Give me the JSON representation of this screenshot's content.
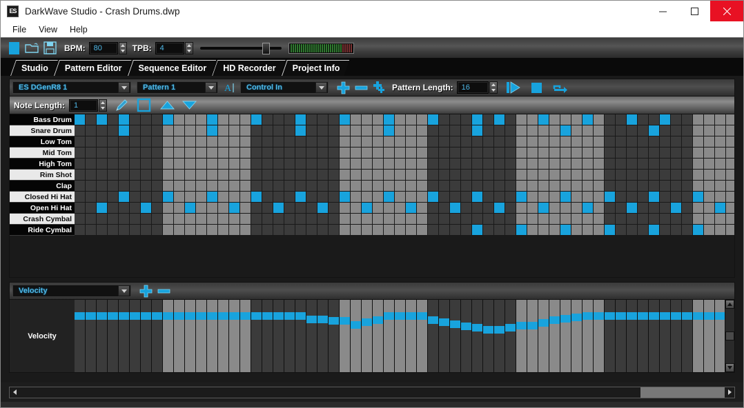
{
  "window": {
    "title": "DarkWave Studio - Crash Drums.dwp",
    "app_icon": "ES",
    "minimize_label": "minimize",
    "maximize_label": "maximize",
    "close_label": "close",
    "close_color": "#e81123"
  },
  "menu": {
    "items": [
      "File",
      "View",
      "Help"
    ]
  },
  "toolbar": {
    "icons": [
      "new-file-icon",
      "open-folder-icon",
      "save-disk-icon"
    ],
    "bpm_label": "BPM:",
    "bpm_value": "80",
    "tpb_label": "TPB:",
    "tpb_value": "4",
    "volume_slider_value": 78,
    "meter_name": "level-meter"
  },
  "tabs": {
    "items": [
      "Studio",
      "Pattern Editor",
      "Sequence Editor",
      "HD Recorder",
      "Project Info"
    ],
    "active": "Pattern Editor"
  },
  "pattern_toolbar": {
    "machine": "ES DGenR8 1",
    "pattern": "Pattern 1",
    "rename_icon": "rename-text-icon",
    "control": "Control In",
    "add_label": "+",
    "remove_label": "–",
    "add_multi_label": "add-multiple",
    "pattern_length_label": "Pattern Length:",
    "pattern_length_value": "16",
    "play_label": "play",
    "stop_label": "stop",
    "loop_label": "loop"
  },
  "note_toolbar": {
    "note_length_label": "Note Length:",
    "note_length_value": "1",
    "pencil_icon": "pencil-tool-icon",
    "select_icon": "select-rect-icon",
    "up_icon": "triangle-up-icon",
    "down_icon": "triangle-down-icon"
  },
  "accent_color": "#18a3dd",
  "grid": {
    "columns": 60,
    "rows": [
      {
        "name": "Bass Drum",
        "steps": [
          0,
          2,
          4,
          8,
          12,
          16,
          20,
          24,
          28,
          32,
          36,
          38,
          42,
          46,
          50,
          53
        ]
      },
      {
        "name": "Snare Drum",
        "steps": [
          4,
          12,
          20,
          28,
          36,
          44,
          52
        ]
      },
      {
        "name": "Low Tom",
        "steps": []
      },
      {
        "name": "Mid Tom",
        "steps": []
      },
      {
        "name": "High Tom",
        "steps": []
      },
      {
        "name": "Rim Shot",
        "steps": []
      },
      {
        "name": "Clap",
        "steps": []
      },
      {
        "name": "Closed Hi Hat",
        "steps": [
          4,
          8,
          12,
          16,
          20,
          24,
          28,
          32,
          36,
          40,
          44,
          48,
          52,
          56
        ]
      },
      {
        "name": "Open Hi Hat",
        "steps": [
          2,
          6,
          10,
          14,
          18,
          22,
          26,
          30,
          34,
          38,
          42,
          46,
          50,
          54,
          58
        ]
      },
      {
        "name": "Crash Cymbal",
        "steps": []
      },
      {
        "name": "Ride Cymbal",
        "steps": [
          36,
          40,
          44,
          48,
          52,
          56
        ]
      }
    ]
  },
  "velocity": {
    "title": "Velocity",
    "panel_label": "Velocity",
    "add_label": "+",
    "remove_label": "–",
    "values": [
      100,
      100,
      100,
      100,
      100,
      100,
      100,
      100,
      100,
      100,
      100,
      100,
      100,
      100,
      100,
      100,
      100,
      100,
      100,
      100,
      100,
      90,
      90,
      84,
      84,
      72,
      80,
      88,
      100,
      100,
      100,
      100,
      86,
      80,
      74,
      68,
      62,
      56,
      56,
      62,
      70,
      70,
      78,
      86,
      92,
      96,
      100,
      100,
      100,
      100,
      100,
      100,
      100,
      100,
      100,
      100,
      100,
      100,
      100,
      100
    ],
    "max": 100
  },
  "hscroll": {
    "name": "horizontal-scrollbar",
    "thumb_position": "right"
  }
}
